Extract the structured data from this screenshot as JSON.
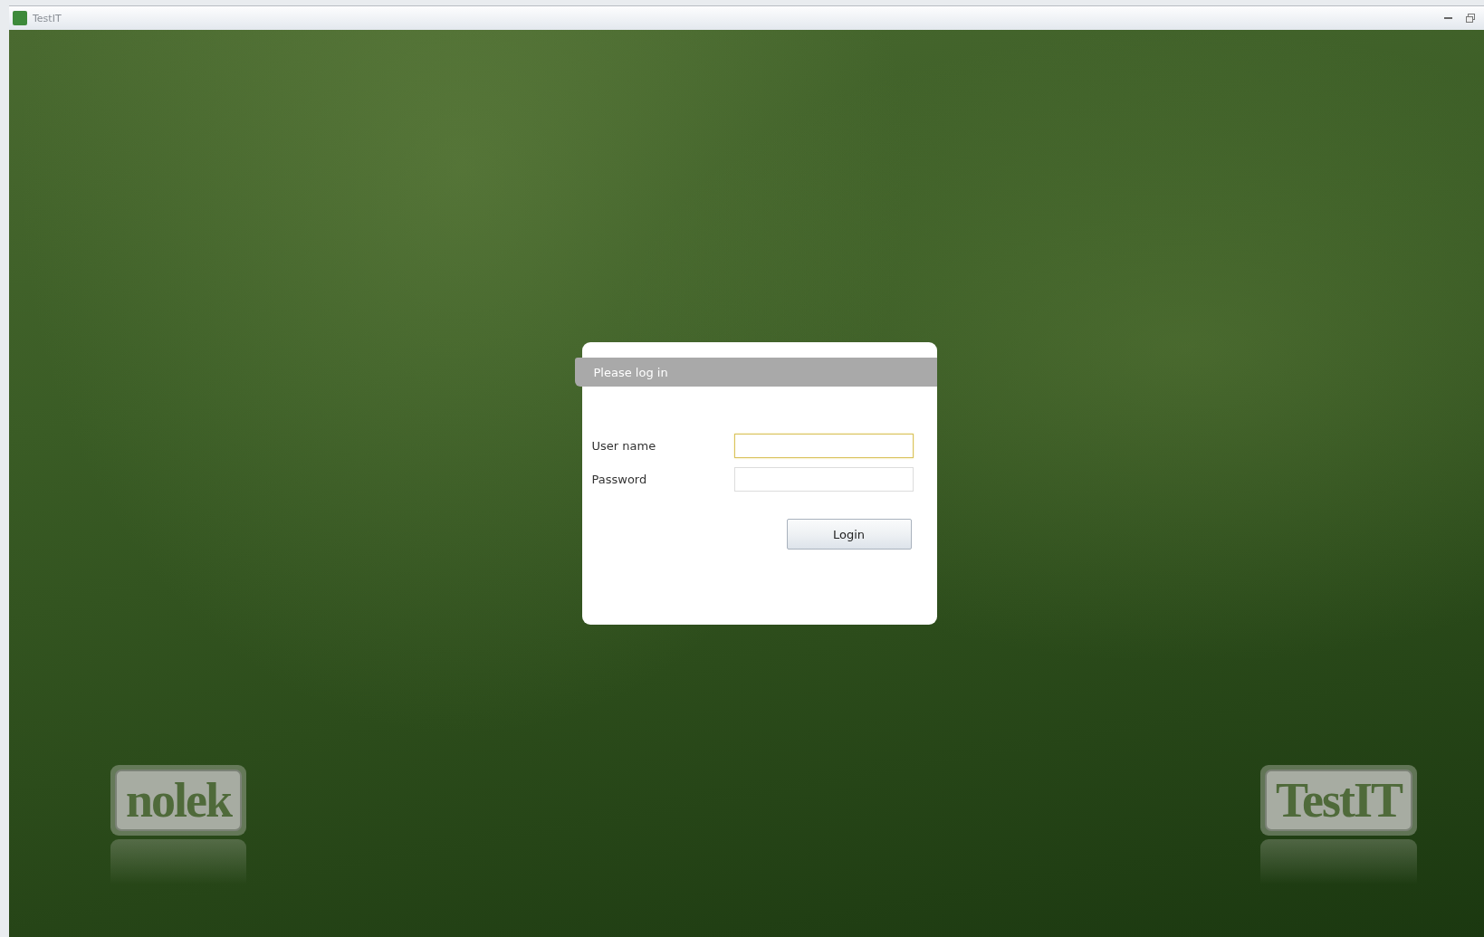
{
  "window": {
    "title": "TestIT"
  },
  "dialog": {
    "title": "Please log in",
    "fields": [
      {
        "label": "User name",
        "focused": true
      },
      {
        "label": "Password",
        "focused": false
      }
    ],
    "button": "Login"
  },
  "logos": [
    {
      "text": "nolek"
    },
    {
      "text": "TestIT"
    }
  ]
}
